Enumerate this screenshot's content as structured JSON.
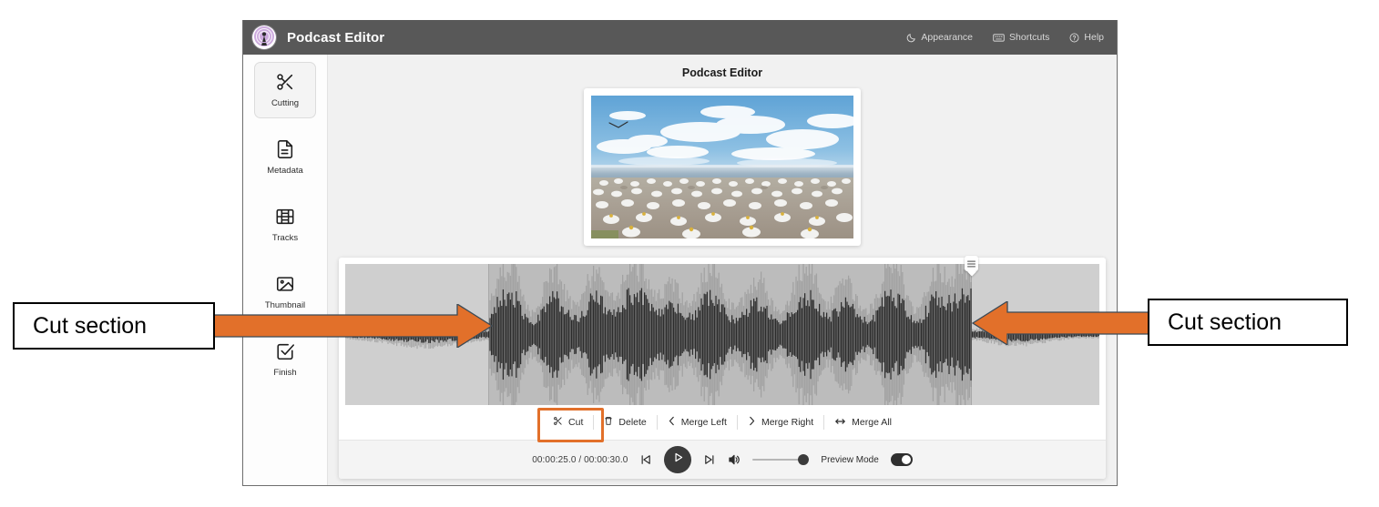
{
  "app": {
    "title": "Podcast Editor",
    "logo_icon": "podcast-tower-icon",
    "titlebar_actions": [
      {
        "label": "Appearance",
        "icon": "moon-icon"
      },
      {
        "label": "Shortcuts",
        "icon": "keyboard-icon"
      },
      {
        "label": "Help",
        "icon": "question-circle-icon"
      }
    ]
  },
  "sidebar": {
    "items": [
      {
        "label": "Cutting",
        "icon": "scissors-icon",
        "active": true
      },
      {
        "label": "Metadata",
        "icon": "document-icon",
        "active": false
      },
      {
        "label": "Tracks",
        "icon": "film-strip-icon",
        "active": false
      },
      {
        "label": "Thumbnail",
        "icon": "image-icon",
        "active": false
      },
      {
        "label": "Finish",
        "icon": "check-square-icon",
        "active": false
      }
    ]
  },
  "main": {
    "page_title": "Podcast Editor",
    "preview": {
      "alt": "gannet-colony-video-still"
    },
    "edit_toolbar": {
      "buttons": [
        {
          "label": "Cut",
          "icon": "scissors-icon",
          "highlighted": true
        },
        {
          "label": "Delete",
          "icon": "trash-icon",
          "highlighted": false
        },
        {
          "label": "Merge Left",
          "icon": "chevron-left-icon",
          "highlighted": false
        },
        {
          "label": "Merge Right",
          "icon": "chevron-right-icon",
          "highlighted": false
        },
        {
          "label": "Merge All",
          "icon": "arrows-horizontal-icon",
          "highlighted": false
        }
      ]
    },
    "transport": {
      "current_time": "00:00:25.0",
      "total_time": "00:00:30.0",
      "time_display": "00:00:25.0 / 00:00:30.0",
      "skip_back_icon": "skip-back-icon",
      "play_icon": "play-icon",
      "skip_forward_icon": "skip-forward-icon",
      "volume_icon": "volume-icon",
      "volume_level": 100,
      "preview_mode_label": "Preview Mode",
      "preview_mode_on": true
    },
    "waveform": {
      "selection_start_pct": 19,
      "selection_end_pct": 83,
      "handle_icon": "grip-handle-icon"
    }
  },
  "annotations": {
    "left": {
      "text": "Cut section",
      "arrow_direction": "right"
    },
    "right": {
      "text": "Cut section",
      "arrow_direction": "left"
    },
    "accent_color": "#E2702A"
  }
}
